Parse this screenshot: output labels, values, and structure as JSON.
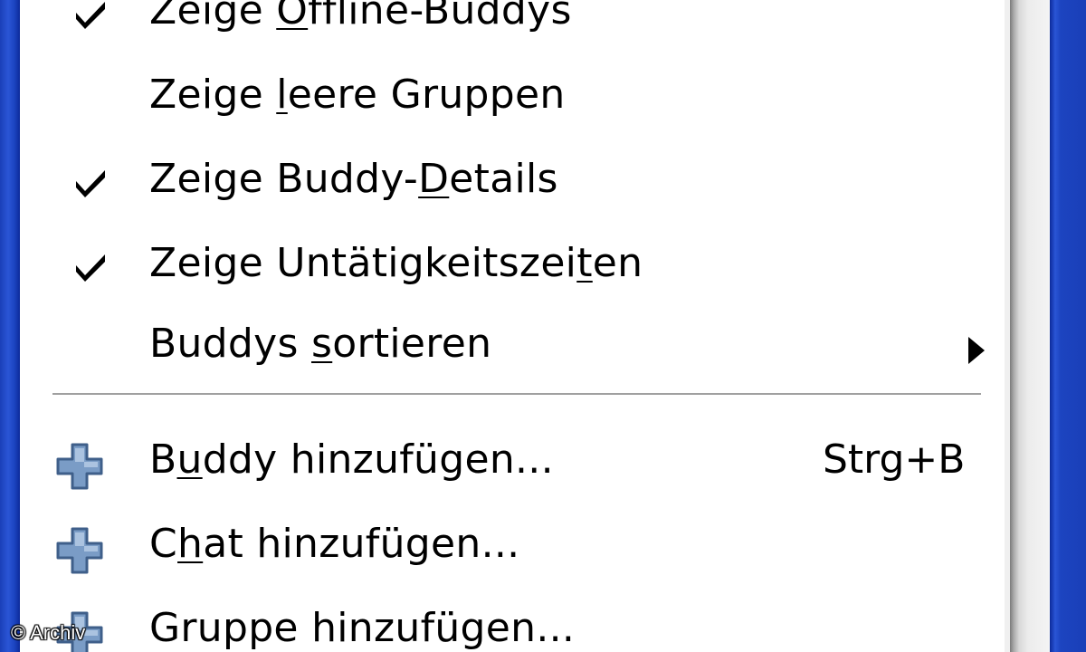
{
  "menu": {
    "items": [
      {
        "label_pre": "Zeige ",
        "label_key": "O",
        "label_post": "ffline-Buddys",
        "checked": true,
        "icon": "checkmark-icon"
      },
      {
        "label_pre": "Zeige ",
        "label_key": "l",
        "label_post": "eere Gruppen",
        "checked": false
      },
      {
        "label_pre": "Zeige Buddy-",
        "label_key": "D",
        "label_post": "etails",
        "checked": true,
        "icon": "checkmark-icon"
      },
      {
        "label_pre": "Zeige Untätigkeitszei",
        "label_key": "t",
        "label_post": "en",
        "checked": true,
        "icon": "checkmark-icon"
      },
      {
        "label_pre": "Buddys ",
        "label_key": "s",
        "label_post": "ortieren",
        "submenu": true,
        "icon": "submenu-arrow-icon"
      },
      {
        "label_pre": "B",
        "label_key": "u",
        "label_post": "ddy hinzufügen...",
        "shortcut": "Strg+B",
        "icon": "plus-icon"
      },
      {
        "label_pre": "C",
        "label_key": "h",
        "label_post": "at hinzufügen...",
        "icon": "plus-icon"
      },
      {
        "label_pre": "Gruppe hinzufügen...",
        "label_key": "",
        "label_post": "",
        "icon": "plus-icon"
      }
    ]
  },
  "watermark": "© Archiv",
  "colors": {
    "window_border": "#2a55d6",
    "menu_background": "#ffffff",
    "separator": "#a0a0a0",
    "plus_icon": "#6b8cb8"
  }
}
